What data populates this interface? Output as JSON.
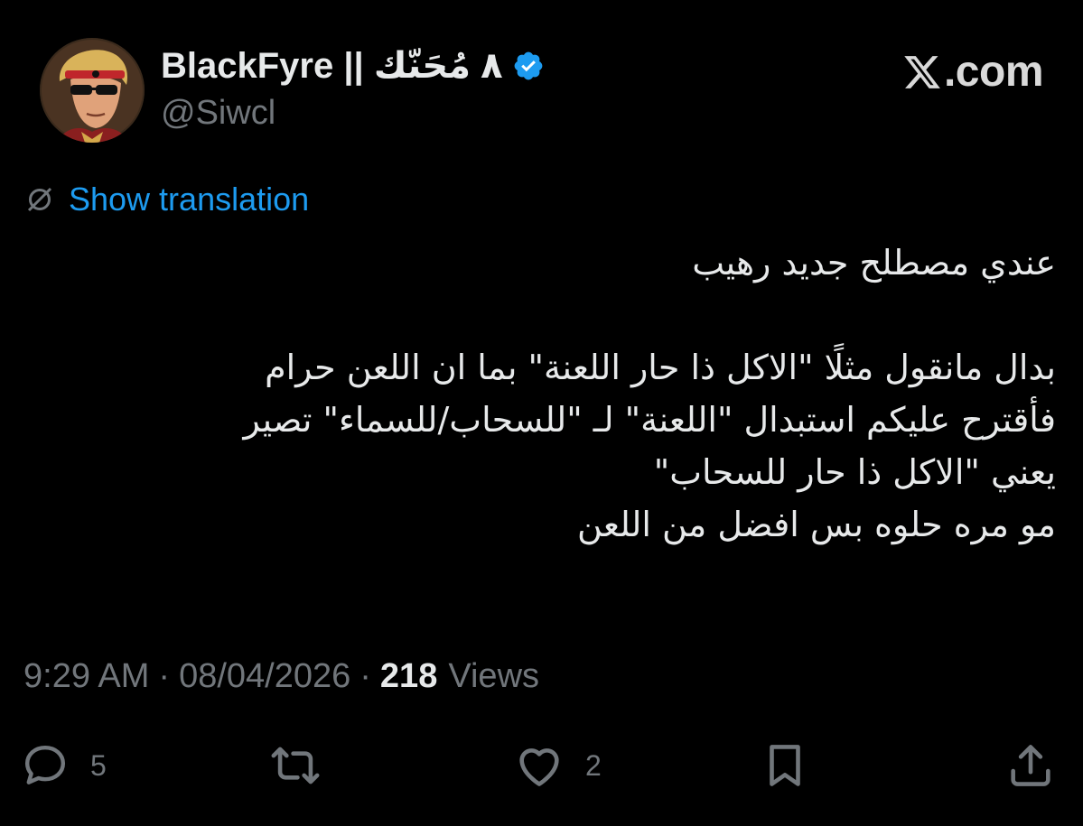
{
  "header": {
    "display_name": "BlackFyre || ٨ مُحَنّك",
    "handle": "@Siwcl",
    "brand_text": ".com",
    "avatar_icon": "avatar-icon",
    "verified_icon": "verified-badge-icon",
    "verified_color": "#1d9bf0"
  },
  "translation": {
    "label": "Show translation",
    "icon": "globe-slash-icon",
    "link_color": "#1d9bf0"
  },
  "tweet": {
    "lines": [
      "عندي مصطلح جديد رهيب",
      "",
      "بدال مانقول مثلًا \"الاكل ذا حار اللعنة\" بما ان اللعن حرام",
      "فأقترح عليكم استبدال \"اللعنة\" لـ \"للسحاب/للسماء\" تصير",
      "يعني \"الاكل ذا حار للسحاب\"",
      "مو مره حلوه بس افضل من اللعن"
    ]
  },
  "meta": {
    "time": "9:29 AM",
    "separator": "·",
    "date": "08/04/2026",
    "views_count": "218",
    "views_label": "Views"
  },
  "actions": {
    "reply_count": "5",
    "like_count": "2",
    "reply_icon": "reply-icon",
    "retweet_icon": "retweet-icon",
    "like_icon": "heart-icon",
    "bookmark_icon": "bookmark-icon",
    "share_icon": "share-icon",
    "icon_color": "#71767b"
  },
  "colors": {
    "background": "#000000",
    "text_primary": "#e7e9ea",
    "text_secondary": "#71767b"
  }
}
